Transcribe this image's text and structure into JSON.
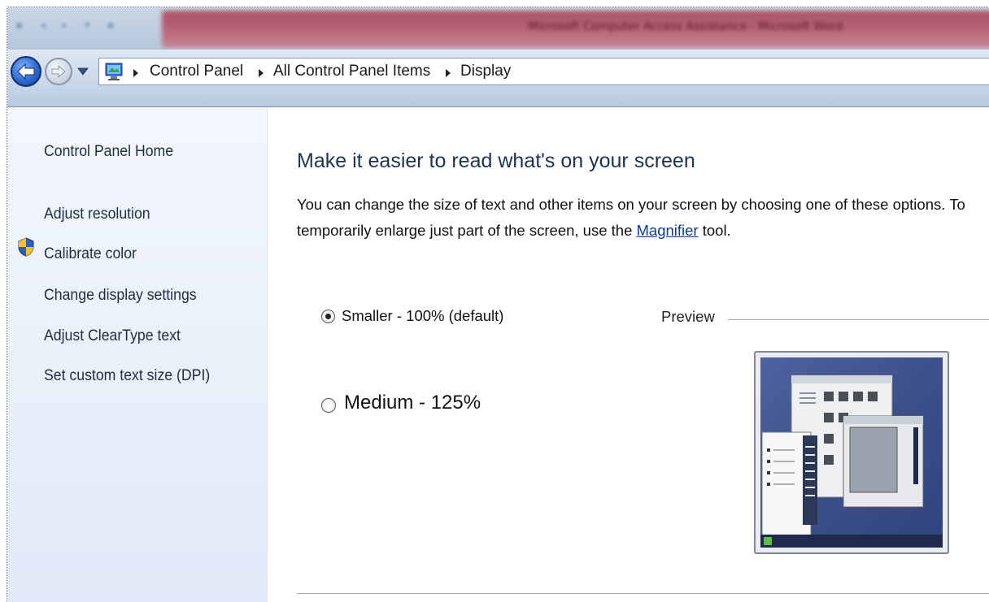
{
  "window": {
    "title_blurred": "Microsoft Computer Access Assistance - Microsoft Word"
  },
  "nav": {
    "breadcrumbs": [
      "Control Panel",
      "All Control Panel Items",
      "Display"
    ]
  },
  "sidebar": {
    "home": "Control Panel Home",
    "items": [
      {
        "label": "Adjust resolution",
        "icon": null
      },
      {
        "label": "Calibrate color",
        "icon": "uac-shield-icon"
      },
      {
        "label": "Change display settings",
        "icon": null
      },
      {
        "label": "Adjust ClearType text",
        "icon": null
      },
      {
        "label": "Set custom text size (DPI)",
        "icon": null
      }
    ]
  },
  "main": {
    "heading": "Make it easier to read what's on your screen",
    "description_before": "You can change the size of text and other items on your screen by choosing one of these options. To temporarily enlarge just part of the screen, use the ",
    "magnifier_link": "Magnifier",
    "description_after": " tool.",
    "options": [
      {
        "label": "Smaller - 100% (default)",
        "selected": true
      },
      {
        "label": "Medium - 125%",
        "selected": false
      }
    ],
    "preview_label": "Preview"
  },
  "colors": {
    "heading": "#1e3252",
    "link": "#0b3d91",
    "sidebar_bg": "#e9f0fa",
    "preview_bg": "#3b4f8c"
  }
}
